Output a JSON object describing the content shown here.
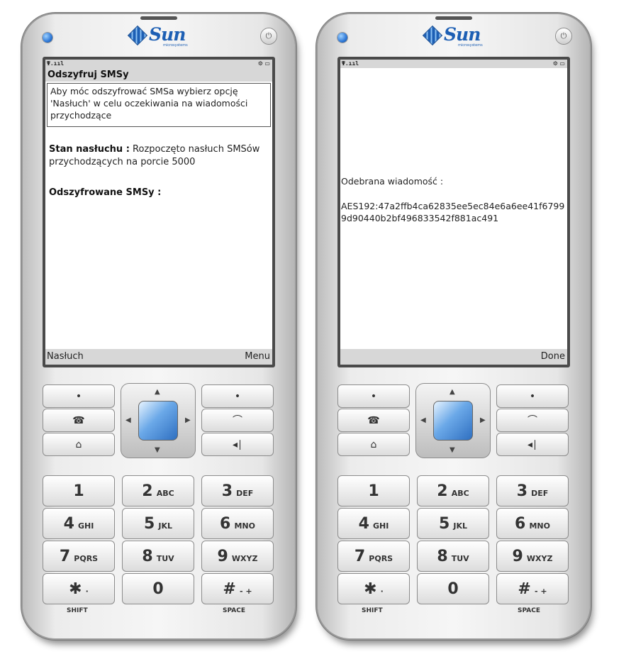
{
  "left_phone": {
    "logo": {
      "brand": "Sun",
      "sub": "microsystems"
    },
    "status": {
      "signal": "Ψ.ııl",
      "icons": "⚙ ▭"
    },
    "screen_title": "Odszyfruj SMSy",
    "info_text": " Aby móc odszyfrować SMSa wybierz opcję 'Nasłuch' w celu oczekiwania na wiadomości przychodzące",
    "listen_label": "Stan nasłuchu :",
    "listen_value": " Rozpoczęto nasłuch SMSów przychodzących na porcie 5000",
    "decoded_label": "Odszyfrowane SMSy :",
    "softkey_left": "Nasłuch",
    "softkey_right": "Menu"
  },
  "right_phone": {
    "logo": {
      "brand": "Sun",
      "sub": "microsystems"
    },
    "status": {
      "signal": "Ψ.ııl",
      "icons": "⚙ ▭"
    },
    "received_label": "Odebrana wiadomość :",
    "received_message": "AES192:47a2ffb4ca62835ee5ec84e6a6ee41f67999d90440b2bf496833542f881ac491",
    "softkey_right": "Done"
  },
  "keypad": {
    "side_keys": [
      "•",
      "☎",
      "⌂",
      "•",
      "⌒",
      "◂∣"
    ],
    "keys": [
      {
        "num": "1",
        "letters": ""
      },
      {
        "num": "2",
        "letters": "ABC"
      },
      {
        "num": "3",
        "letters": "DEF"
      },
      {
        "num": "4",
        "letters": "GHI"
      },
      {
        "num": "5",
        "letters": "JKL"
      },
      {
        "num": "6",
        "letters": "MNO"
      },
      {
        "num": "7",
        "letters": "PQRS"
      },
      {
        "num": "8",
        "letters": "TUV"
      },
      {
        "num": "9",
        "letters": "WXYZ"
      },
      {
        "num": "✱",
        "letters": "·"
      },
      {
        "num": "0",
        "letters": ""
      },
      {
        "num": "#",
        "letters": "- +"
      }
    ],
    "shift_label": "SHIFT",
    "space_label": "SPACE"
  }
}
